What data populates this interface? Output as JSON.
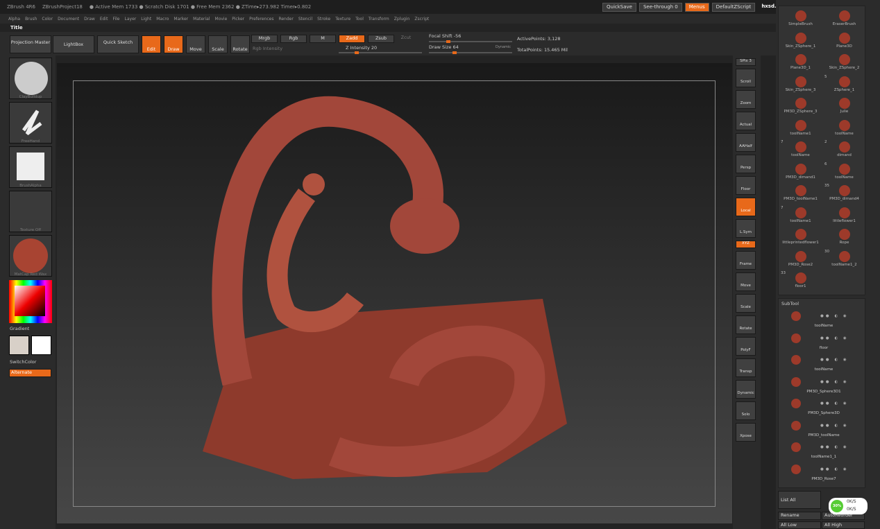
{
  "titlebar": {
    "app": "ZBrush 4R6",
    "project": "ZBrushProject18",
    "mem": "● Active Mem 1733  ● Scratch Disk 1701  ● Free Mem 2362  ● ZTime▸273.982 Timer▸0.802"
  },
  "topright": {
    "quicksave": "QuickSave",
    "seethrough": "See-through   0",
    "menus": "Menus",
    "script": "DefaultZScript",
    "watermark": "hxsd.com"
  },
  "menu": [
    "Alpha",
    "Brush",
    "Color",
    "Document",
    "Draw",
    "Edit",
    "File",
    "Layer",
    "Light",
    "Macro",
    "Marker",
    "Material",
    "Movie",
    "Picker",
    "Preferences",
    "Render",
    "Stencil",
    "Stroke",
    "Texture",
    "Tool",
    "Transform",
    "Zplugin",
    "Zscript"
  ],
  "title": "Title",
  "toolbar": {
    "projection": "Projection Master",
    "lightbox": "LightBox",
    "quicksketch": "Quick Sketch",
    "edit": "Edit",
    "draw": "Draw",
    "move": "Move",
    "scale": "Scale",
    "rotate": "Rotate",
    "mrgb": "Mrgb",
    "rgb": "Rgb",
    "m": "M",
    "rgb_intensity": "Rgb Intensity",
    "zadd": "Zadd",
    "zsub": "Zsub",
    "zcut": "Zcut",
    "z_intensity": "Z Intensity 20",
    "focal": "Focal Shift -56",
    "drawsize": "Draw Size 64",
    "dynamic": "Dynamic",
    "active": "ActivePoints: 3,128",
    "total": "TotalPoints: 15.465 Mil",
    "z_intensity_value": 0.2,
    "focal_value": 0.22,
    "drawsize_value": 0.3
  },
  "left": {
    "brush1": "ClayBuildup",
    "brush2": "FreeHand",
    "brush3": "BrushAlpha",
    "texture": "Texture Off",
    "material": "MatCap Red Wax",
    "gradient": "Gradient",
    "switch": "SwitchColor",
    "alternate": "Alternate"
  },
  "right": [
    "SPix 3",
    "Scroll",
    "Zoom",
    "Actual",
    "AAHalf",
    "Persp",
    "Floor",
    "Local",
    "L.Sym",
    "XYZ",
    "Frame",
    "Move",
    "Scale",
    "Rotate",
    "PolyF",
    "Transp",
    "Dynamic",
    "Solo",
    "Xpose"
  ],
  "tools": [
    [
      "SimpleBrush",
      ""
    ],
    [
      "EraserBrush",
      ""
    ],
    [
      "Skin_ZSphere_1",
      ""
    ],
    [
      "Plane3D",
      ""
    ],
    [
      "Plane3D_1",
      ""
    ],
    [
      "Skin_ZSphere_2",
      ""
    ],
    [
      "Skin_ZSphere_3",
      ""
    ],
    [
      "ZSphere_1",
      "5"
    ],
    [
      "PM3D_ZSphere_3",
      ""
    ],
    [
      "Julie",
      ""
    ],
    [
      "toolName1",
      ""
    ],
    [
      "toolName",
      ""
    ],
    [
      "toolName",
      "7"
    ],
    [
      "dimand",
      "2"
    ],
    [
      "PM3D_dimand1",
      ""
    ],
    [
      "toolName",
      "6"
    ],
    [
      "PM3D_toolName1",
      ""
    ],
    [
      "PM3D_dimand4",
      "35"
    ],
    [
      "toolName1",
      "7"
    ],
    [
      "littleflower1",
      ""
    ],
    [
      "littleprintedflower1",
      ""
    ],
    [
      "Rope",
      ""
    ],
    [
      "PM3D_Rose2",
      ""
    ],
    [
      "toolName1_2",
      "30"
    ],
    [
      "floor1",
      "33"
    ]
  ],
  "subtool": {
    "header": "SubTool",
    "items": [
      "toolName",
      "floor",
      "toolName",
      "PM3D_Sphere3D1",
      "PM3D_Sphere3D",
      "PM3D_toolName",
      "toolName1_1",
      "PM3D_Rose7"
    ],
    "listall": "List All",
    "rename": "Rename",
    "autoreorder": "AutoReorder",
    "alllow": "All Low",
    "allhigh": "All High"
  },
  "stats": {
    "pct": "30%",
    "up": "0K/S",
    "down": "0K/S"
  }
}
